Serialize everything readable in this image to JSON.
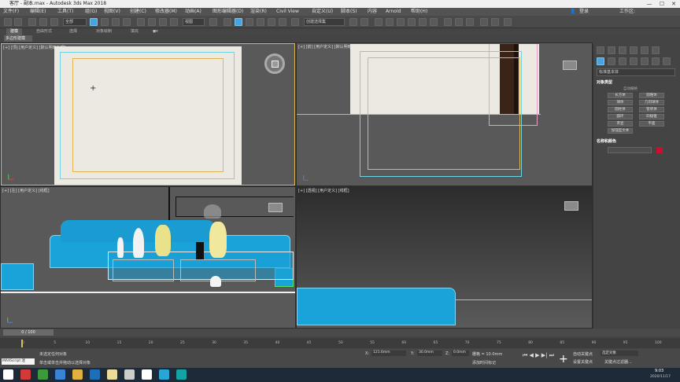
{
  "window": {
    "title": "客厅 - 副本.max - Autodesk 3ds Max 2018",
    "controls": {
      "minimize": "—",
      "maximize": "☐",
      "close": "✕"
    }
  },
  "menu": [
    "文件(F)",
    "编辑(E)",
    "工具(T)",
    "组(G)",
    "视图(V)",
    "创建(C)",
    "修改器(M)",
    "动画(A)",
    "图形编辑器(D)",
    "渲染(R)",
    "Civil View",
    "自定义(U)",
    "脚本(S)",
    "内容",
    "Arnold",
    "帮助(H)"
  ],
  "account": {
    "login_label": "登录",
    "workspace_label": "工作区:"
  },
  "toolbar": {
    "filter_select": "全部",
    "view_select": "视图",
    "selection_set_placeholder": "创建选择集"
  },
  "ribbon": {
    "tabs": [
      "建模",
      "自由形式",
      "选择",
      "对象绘制",
      "填充"
    ],
    "subtab": "多边形建模"
  },
  "viewports": [
    {
      "label": "[+] [顶] [用户定义] [默认明暗处理]"
    },
    {
      "label": "[+] [前] [用户定义] [默认明暗处理]"
    },
    {
      "label": "[+] [左] [用户定义] [线框]"
    },
    {
      "label": "[+] [透视] [用户定义] [线框]"
    }
  ],
  "command_panel": {
    "dropdown": "标准基本体",
    "object_type_header": "对象类型",
    "autogrid_label": "自动栅格",
    "buttons": [
      "长方体",
      "圆锥体",
      "球体",
      "几何球体",
      "圆柱体",
      "管状体",
      "圆环",
      "四棱锥",
      "茶壶",
      "平面",
      "加强型文本"
    ],
    "name_color_header": "名称和颜色",
    "color_swatch": "#c8102e"
  },
  "timeline": {
    "frame_display": "0 / 100",
    "ticks": [
      "0",
      "5",
      "10",
      "15",
      "20",
      "25",
      "30",
      "35",
      "40",
      "45",
      "50",
      "55",
      "60",
      "65",
      "70",
      "75",
      "80",
      "85",
      "90",
      "95",
      "100"
    ]
  },
  "status": {
    "maxscript_label": "MAXScript 迷",
    "line1": "未选定任何对象",
    "line2": "单击或单击并拖动以选择对象",
    "x_label": "X:",
    "x_value": "121.6mm",
    "y_label": "Y:",
    "y_value": "30.0mm",
    "z_label": "Z:",
    "z_value": "0.0mm",
    "grid_label": "栅格 = 10.0mm",
    "add_time_tag": "添加时间标记",
    "auto_key_label": "自动关键点",
    "selected_object_label": "选定对象",
    "set_key_label": "设置关键点",
    "key_filter_label": "关键点过滤器..."
  },
  "taskbar": {
    "time": "9:03",
    "date": "2020/11/17",
    "app_icons": [
      "windows-icon",
      "search-icon",
      "chrome-icon",
      "app-red-icon",
      "wechat-icon",
      "qq-icon",
      "edge-icon",
      "folder-icon",
      "3dsmax-icon",
      "vray-icon",
      "s-icon",
      "app3-icon"
    ]
  }
}
